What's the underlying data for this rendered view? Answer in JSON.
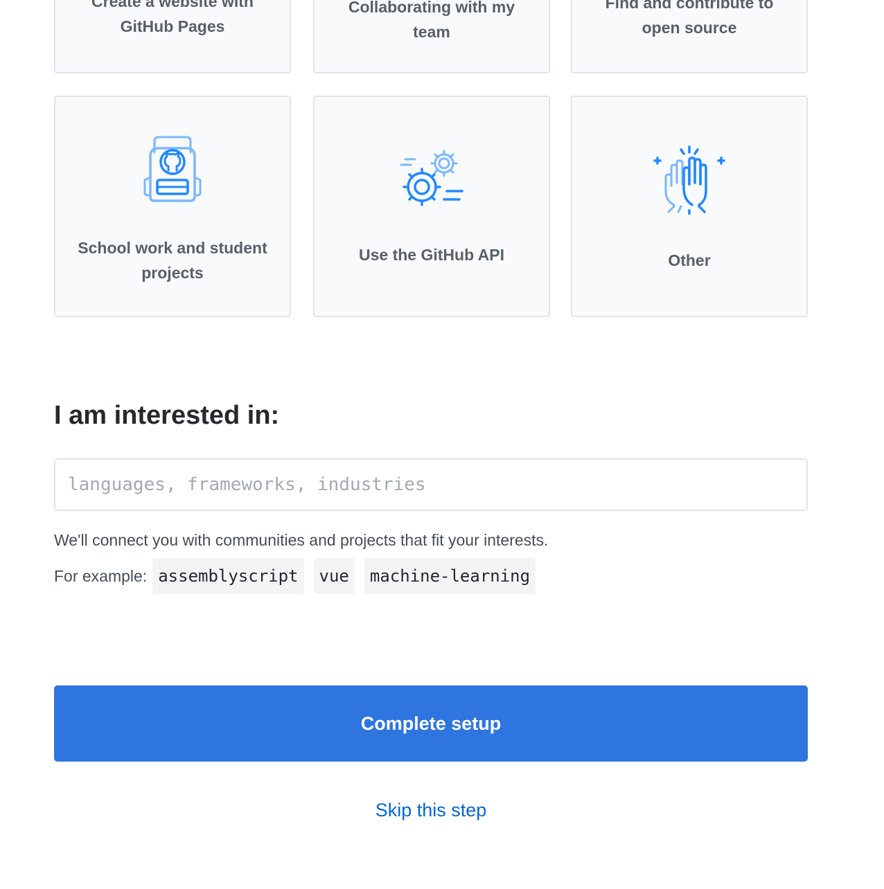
{
  "cards_top_row": [
    {
      "label_line1": "Create a website with",
      "label_line2": "GitHub Pages"
    },
    {
      "label_line1": "Collaborating with my",
      "label_line2": "team"
    },
    {
      "label_line1": "Find and contribute to",
      "label_line2": "open source"
    }
  ],
  "cards_bottom_row": [
    {
      "label_line1": "School work and student",
      "label_line2": "projects",
      "icon": "backpack-icon"
    },
    {
      "label_line1": "Use the GitHub API",
      "icon": "gears-icon"
    },
    {
      "label_line1": "Other",
      "icon": "high-five-icon"
    }
  ],
  "interests": {
    "heading": "I am interested in:",
    "input_value": "",
    "input_placeholder": "languages, frameworks, industries",
    "hint": "We'll connect you with communities and projects that fit your interests.",
    "examples_label": "For example:",
    "examples": [
      "assemblyscript",
      "vue",
      "machine-learning"
    ]
  },
  "actions": {
    "complete_label": "Complete setup",
    "skip_label": "Skip this step"
  },
  "colors": {
    "accent": "#2e75e0",
    "link": "#0366d6",
    "icon_light": "#79b8ff",
    "icon_dark": "#2188ff"
  }
}
